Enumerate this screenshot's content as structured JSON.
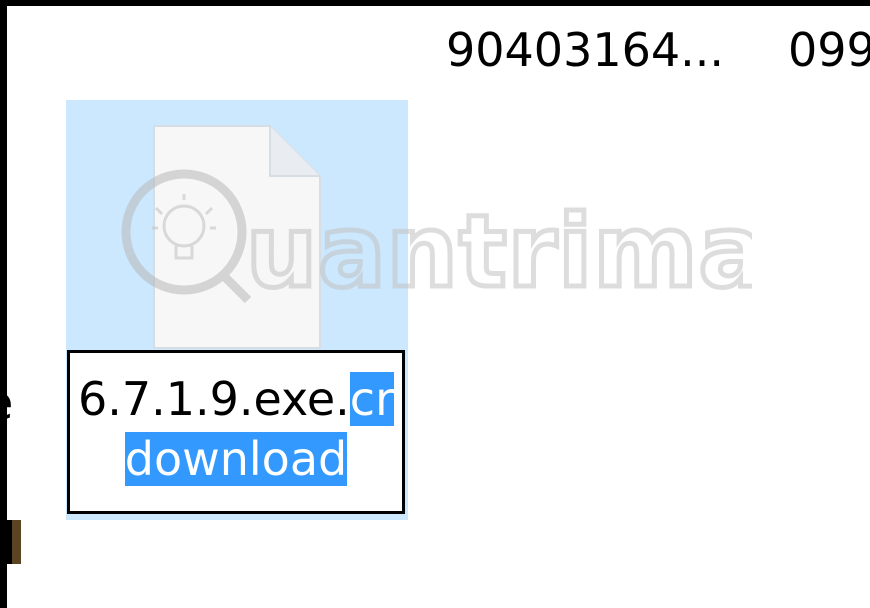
{
  "header": {
    "column_1_text": "90403164...",
    "column_2_text": "099"
  },
  "left_neighbor": {
    "clipped_text": "e"
  },
  "file_item": {
    "icon": "generic-file-icon",
    "rename_line1_plain": "6.7.1.9.exe.",
    "rename_line1_selected": "cr",
    "rename_line2_selected": "download"
  },
  "watermark": {
    "text": "uantrimang",
    "icon": "lightbulb-icon"
  },
  "colors": {
    "selection_background": "#3399ff",
    "item_highlight": "#cce8ff",
    "frame": "#000000"
  }
}
